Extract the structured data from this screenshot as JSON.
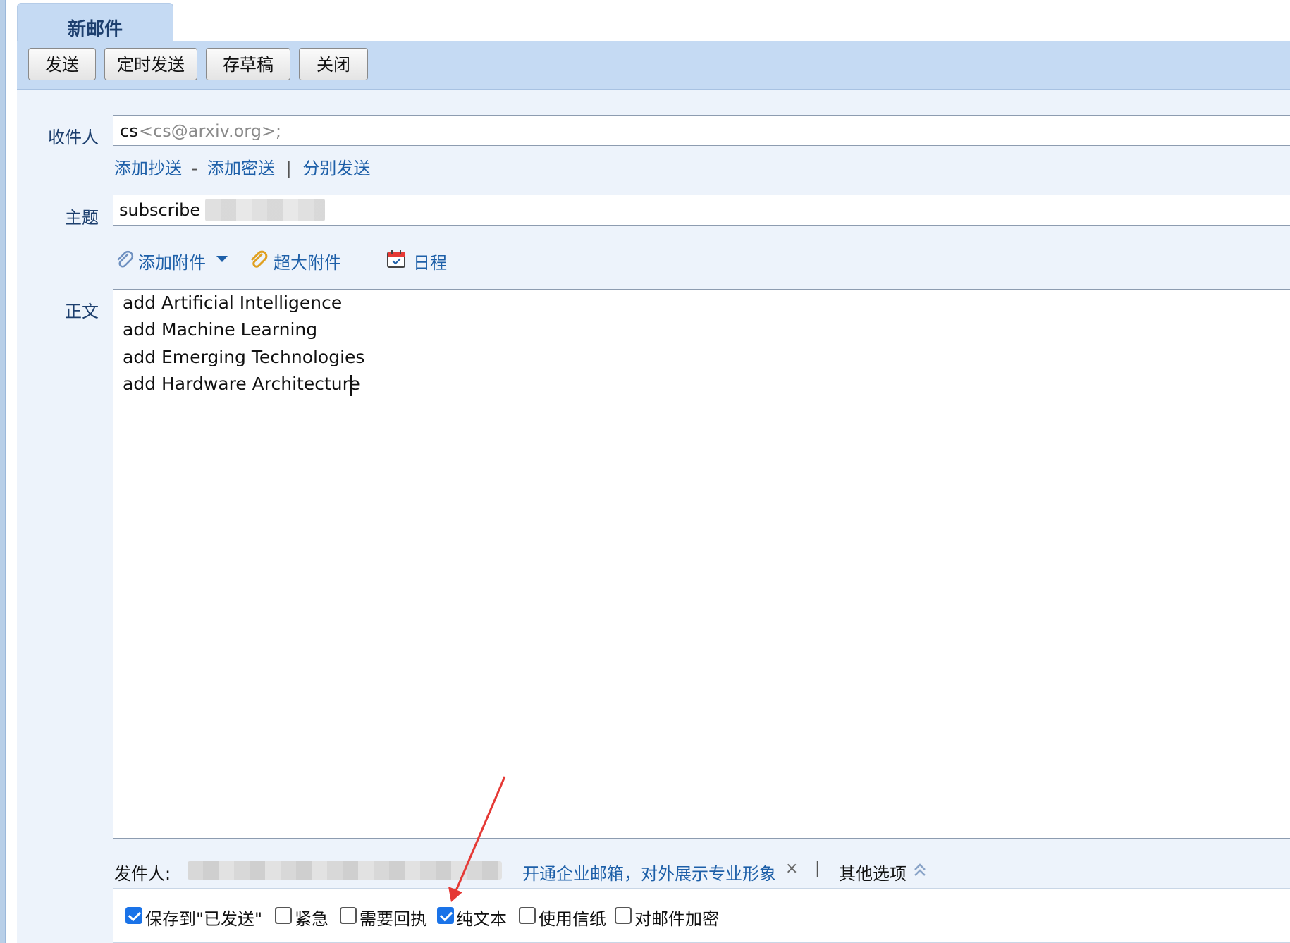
{
  "tab": {
    "title": "新邮件"
  },
  "toolbar": {
    "send": "发送",
    "scheduled_send": "定时发送",
    "save_draft": "存草稿",
    "close": "关闭"
  },
  "recipient": {
    "label": "收件人",
    "name": "cs",
    "address": "<cs@arxiv.org>;",
    "add_cc": "添加抄送",
    "dash": "-",
    "add_bcc": "添加密送",
    "pipe": "|",
    "separate_send": "分别发送"
  },
  "subject": {
    "label": "主题",
    "value": "subscribe"
  },
  "attachments": {
    "add_attachment": "添加附件",
    "large_attachment": "超大附件",
    "schedule": "日程"
  },
  "body": {
    "label": "正文",
    "lines": [
      "add Artificial Intelligence",
      "add Machine Learning",
      "add Emerging Technologies",
      "add Hardware Architecture"
    ]
  },
  "sender": {
    "label": "发件人:",
    "promo": "开通企业邮箱，对外展示专业形象",
    "promo_close": "×",
    "pipe": "|",
    "other_options": "其他选项"
  },
  "options": [
    {
      "label": "保存到\"已发送\"",
      "checked": true
    },
    {
      "label": "紧急",
      "checked": false
    },
    {
      "label": "需要回执",
      "checked": false
    },
    {
      "label": "纯文本",
      "checked": true
    },
    {
      "label": "使用信纸",
      "checked": false
    },
    {
      "label": "对邮件加密",
      "checked": false
    }
  ],
  "colors": {
    "toolbar_bg": "#c5daf3",
    "form_bg": "#edf3fb",
    "link": "#1d5fa8",
    "annotation_arrow": "#e53935",
    "checkbox_on": "#1a73e8"
  },
  "icons": [
    "paperclip-icon",
    "dropdown-caret-icon",
    "gold-paperclip-icon",
    "calendar-icon",
    "chevron-up-icon"
  ]
}
